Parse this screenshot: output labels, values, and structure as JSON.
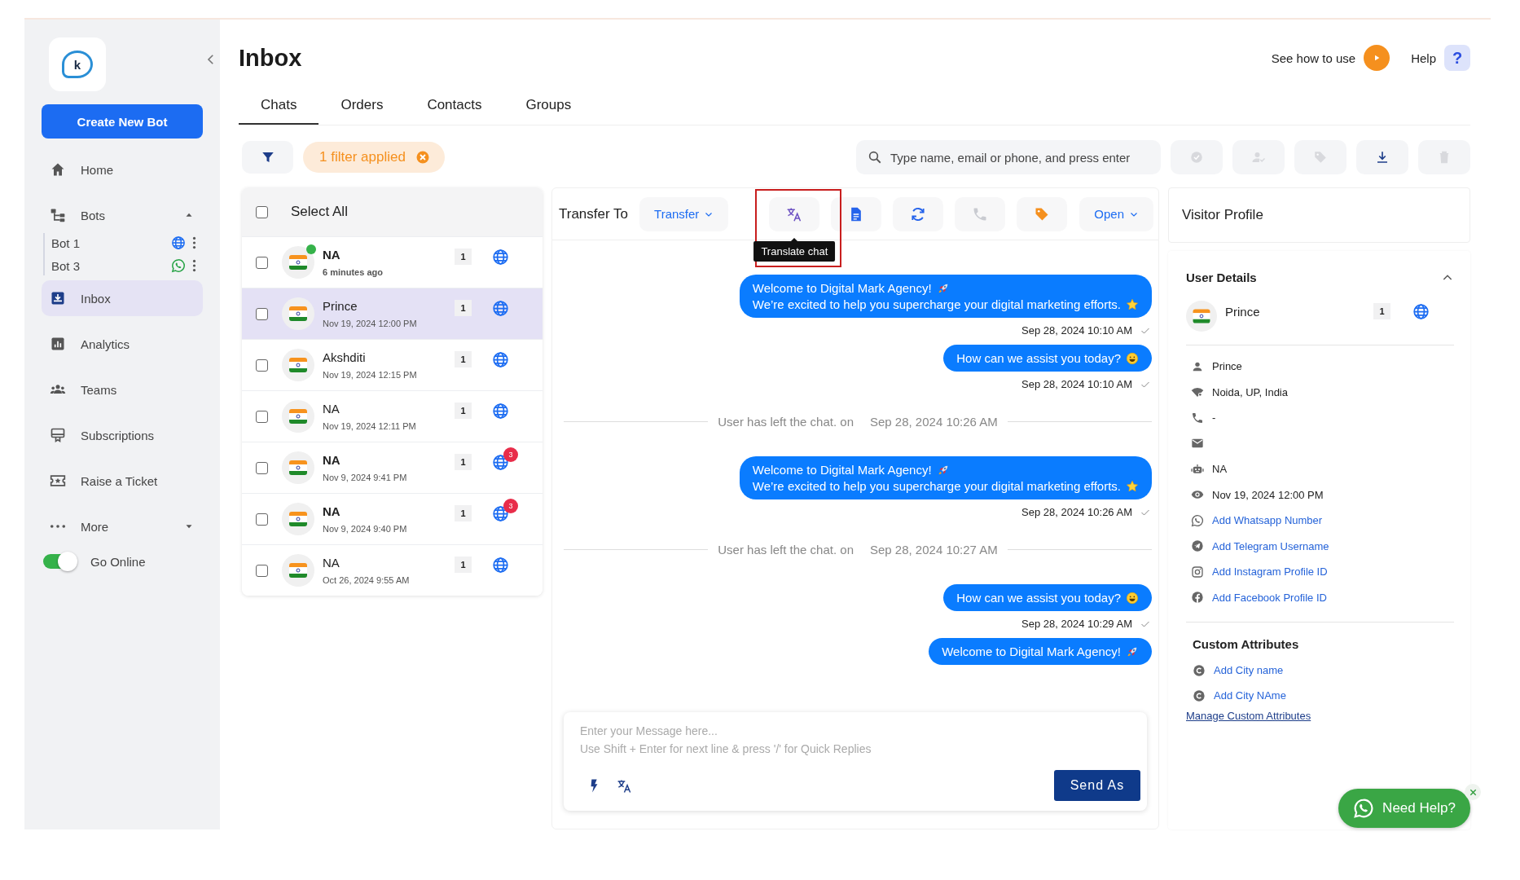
{
  "sidebar": {
    "logo_text": "k",
    "create_button": "Create New Bot",
    "nav": [
      {
        "label": "Home",
        "selected": false
      },
      {
        "label": "Bots",
        "selected": false,
        "expanded": true,
        "children": [
          {
            "label": "Bot 1",
            "kind": "web"
          },
          {
            "label": "Bot 3",
            "kind": "whatsapp"
          }
        ]
      },
      {
        "label": "Inbox",
        "selected": true
      },
      {
        "label": "Analytics",
        "selected": false
      },
      {
        "label": "Teams",
        "selected": false
      },
      {
        "label": "Subscriptions",
        "selected": false
      },
      {
        "label": "Raise a Ticket",
        "selected": false
      },
      {
        "label": "More",
        "selected": false,
        "expanded": false
      }
    ],
    "go_online": {
      "label": "Go Online",
      "on": true
    }
  },
  "header": {
    "title": "Inbox",
    "guide": "See how to use",
    "help": "Help",
    "help_icon": "?",
    "tabs": [
      {
        "label": "Chats",
        "selected": true
      },
      {
        "label": "Orders",
        "selected": false
      },
      {
        "label": "Contacts",
        "selected": false
      },
      {
        "label": "Groups",
        "selected": false
      }
    ]
  },
  "toolbar": {
    "filter_chip": "1 filter applied",
    "search": {
      "placeholder": "Type name, email or phone, and press enter"
    },
    "actions": [
      {
        "disabled": true
      },
      {
        "disabled": true
      },
      {
        "disabled": true
      },
      {
        "disabled": false
      },
      {
        "disabled": true
      }
    ]
  },
  "chat_list": {
    "select_all": {
      "label": "Select All",
      "checked": false
    },
    "rows": [
      {
        "name": "NA",
        "time": "6 minutes ago",
        "unread": true,
        "online": true,
        "selected": false,
        "checked": false,
        "count": "1"
      },
      {
        "name": "Prince",
        "time": "Nov 19, 2024 12:00 PM",
        "unread": false,
        "online": false,
        "selected": true,
        "checked": false,
        "count": "1"
      },
      {
        "name": "Akshditi",
        "time": "Nov 19, 2024 12:15 PM",
        "unread": false,
        "online": false,
        "selected": false,
        "checked": false,
        "count": "1"
      },
      {
        "name": "NA",
        "time": "Nov 19, 2024 12:11 PM",
        "unread": false,
        "online": false,
        "selected": false,
        "checked": false,
        "count": "1"
      },
      {
        "name": "NA",
        "time": "Nov 9, 2024 9:41 PM",
        "unread": true,
        "online": false,
        "selected": false,
        "checked": false,
        "count": "1",
        "badge": "3"
      },
      {
        "name": "NA",
        "time": "Nov 9, 2024 9:40 PM",
        "unread": true,
        "online": false,
        "selected": false,
        "checked": false,
        "count": "1",
        "badge": "3"
      },
      {
        "name": "NA",
        "time": "Oct 26, 2024 9:55 AM",
        "unread": false,
        "online": false,
        "selected": false,
        "checked": false,
        "count": "1"
      }
    ]
  },
  "chat": {
    "transfer_label": "Transfer To",
    "transfer_dropdown": "Transfer",
    "tools": [
      {
        "disabled": false,
        "tooltip": "Translate chat"
      },
      {
        "disabled": false
      },
      {
        "disabled": false
      },
      {
        "disabled": true
      },
      {
        "disabled": false
      }
    ],
    "status_dropdown": "Open",
    "messages": [
      {
        "kind": "bubble",
        "lines": [
          {
            "text": "Welcome to Digital Mark Agency!",
            "kind": "rocket"
          },
          {
            "text": "We’re excited to help you supercharge your digital marketing efforts.",
            "kind": "star"
          }
        ],
        "time": "Sep 28, 2024 10:10 AM",
        "ticked": true
      },
      {
        "kind": "bubble",
        "lines": [
          {
            "text": "How can we assist you today?",
            "kind": "smile"
          }
        ],
        "time": "Sep 28, 2024 10:10 AM",
        "ticked": true
      },
      {
        "kind": "event",
        "text": "User has left the chat. on",
        "time": "Sep 28, 2024 10:26 AM"
      },
      {
        "kind": "bubble",
        "lines": [
          {
            "text": "Welcome to Digital Mark Agency!",
            "kind": "rocket"
          },
          {
            "text": "We’re excited to help you supercharge your digital marketing efforts.",
            "kind": "star"
          }
        ],
        "time": "Sep 28, 2024 10:26 AM",
        "ticked": true
      },
      {
        "kind": "event",
        "text": "User has left the chat. on",
        "time": "Sep 28, 2024 10:27 AM"
      },
      {
        "kind": "bubble",
        "lines": [
          {
            "text": "How can we assist you today?",
            "kind": "smile"
          }
        ],
        "time": "Sep 28, 2024 10:29 AM",
        "ticked": true
      },
      {
        "kind": "bubble",
        "lines": [
          {
            "text": "Welcome to Digital Mark Agency!",
            "kind": "rocket"
          }
        ]
      }
    ],
    "composer": {
      "placeholder": "Enter your Message here...\nUse Shift + Enter for next line & press '/' for Quick Replies",
      "send_button": "Send As"
    }
  },
  "profile": {
    "title": "Visitor Profile",
    "section": "User Details",
    "expanded": true,
    "name": "Prince",
    "count": "1",
    "details": [
      {
        "text": "Prince",
        "kind": "info"
      },
      {
        "text": "Noida, UP, India",
        "kind": "info"
      },
      {
        "text": "-",
        "kind": "info"
      },
      {
        "kind": "info"
      },
      {
        "text": "NA",
        "kind": "info"
      },
      {
        "text": "Nov 19, 2024 12:00 PM",
        "kind": "info"
      },
      {
        "text": "Add Whatsapp Number",
        "kind": "link"
      },
      {
        "text": "Add Telegram Username",
        "kind": "link"
      },
      {
        "text": "Add Instagram Profile ID",
        "kind": "link"
      },
      {
        "text": "Add Facebook Profile ID",
        "kind": "link"
      }
    ],
    "custom_title": "Custom Attributes",
    "custom": [
      {
        "text": "Add City name"
      },
      {
        "text": "Add City NAme"
      }
    ],
    "manage_link": "Manage Custom Attributes"
  },
  "need_help": "Need Help?"
}
